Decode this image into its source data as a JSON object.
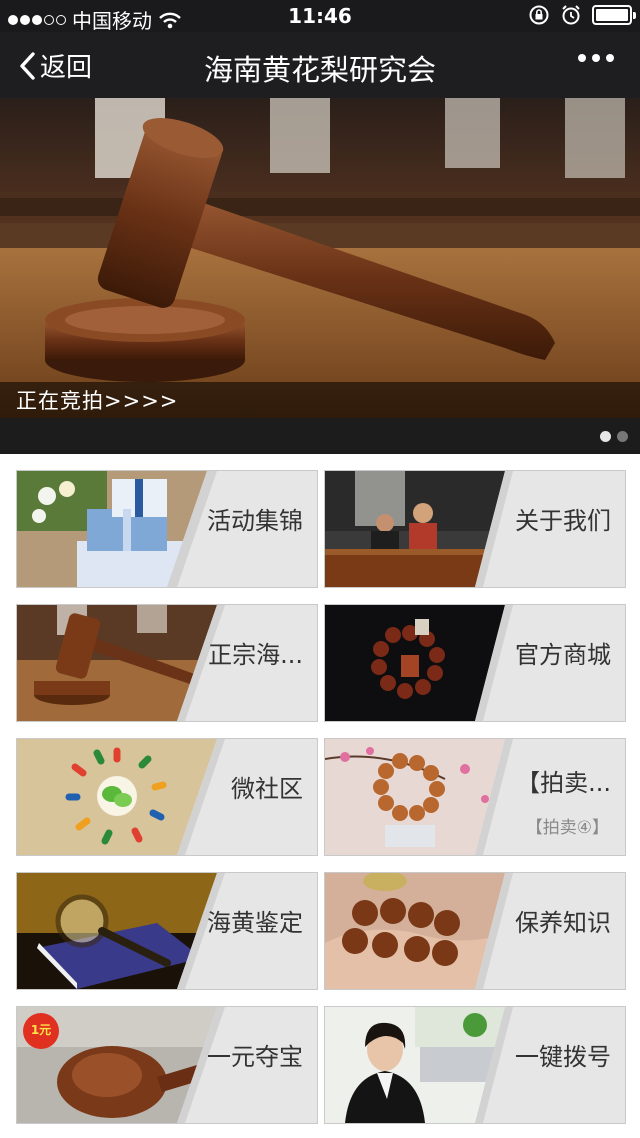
{
  "status_bar": {
    "carrier": "中国移动",
    "time": "11:46",
    "signal_dots_filled": 3,
    "signal_dots_total": 5,
    "battery_level": 1.0
  },
  "nav": {
    "back_label": "返回",
    "title": "海南黄花梨研究会"
  },
  "banner": {
    "caption": "正在竞拍>>>>",
    "pages": 2,
    "active_page": 1
  },
  "tiles": [
    {
      "label": "活动集锦",
      "image": "gift-boxes-image"
    },
    {
      "label": "关于我们",
      "image": "people-at-table-image"
    },
    {
      "label": "正宗海...",
      "image": "gavel-image"
    },
    {
      "label": "官方商城",
      "image": "bead-bracelet-image"
    },
    {
      "label": "微社区",
      "image": "wechat-circle-image"
    },
    {
      "label": "【拍卖...",
      "sublabel": "【拍卖④】",
      "image": "bracelet-display-image"
    },
    {
      "label": "海黄鉴定",
      "image": "magnifier-book-image"
    },
    {
      "label": "保养知识",
      "image": "beads-in-hand-image"
    },
    {
      "label": "一元夺宝",
      "image": "carved-pipe-image",
      "badge": "1元"
    },
    {
      "label": "一键拨号",
      "image": "call-center-agent-image"
    }
  ],
  "colors": {
    "bar_background": "#1e1e20",
    "tile_background": "#e6e6e6",
    "tile_border": "#c9c9c9",
    "label_text": "#333333"
  }
}
